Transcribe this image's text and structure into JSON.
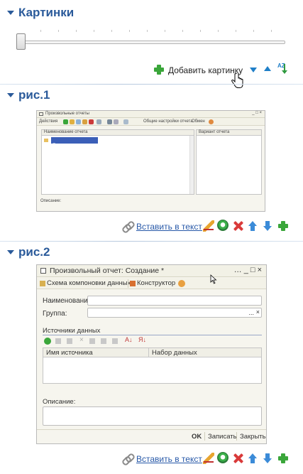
{
  "sections": {
    "pictures": {
      "title": "Картинки"
    },
    "fig1": {
      "title": "рис.1"
    },
    "fig2": {
      "title": "рис.2"
    }
  },
  "slider": {
    "value": 0
  },
  "pictures_toolbar": {
    "add_label": "Добавить картинку",
    "sort_label": "AZ"
  },
  "fig1_actions": {
    "insert_label": "Вставить в текст"
  },
  "fig2_actions": {
    "insert_label": "Вставить в текст"
  },
  "shot1": {
    "title": "Произвольные отчеты",
    "toolbar": {
      "actions_label": "Действия",
      "common_settings_label": "Общие настройки отчета",
      "other_label": "Обмен"
    },
    "left_column_header": "Наименование отчета",
    "tree_item": "Произвольные отчеты",
    "right_column_header": "Вариант отчета",
    "footer_label": "Описание:"
  },
  "shot2": {
    "title": "Произвольный отчет: Создание *",
    "toolbar": {
      "schema_label": "Схема компоновки данных",
      "designer_label": "Конструктор"
    },
    "name_label": "Наименование:",
    "group_label": "Группа:",
    "group_buttons": "...",
    "sources_title": "Источники данных",
    "columns": [
      "Имя источника",
      "Набор данных"
    ],
    "description_label": "Описание:",
    "buttons": {
      "ok": "OK",
      "save": "Записать",
      "close": "Закрыть"
    }
  },
  "colors": {
    "accent": "#2a5a9a",
    "link": "#2859a8",
    "green": "#3aa63a",
    "red": "#d93a3a"
  }
}
